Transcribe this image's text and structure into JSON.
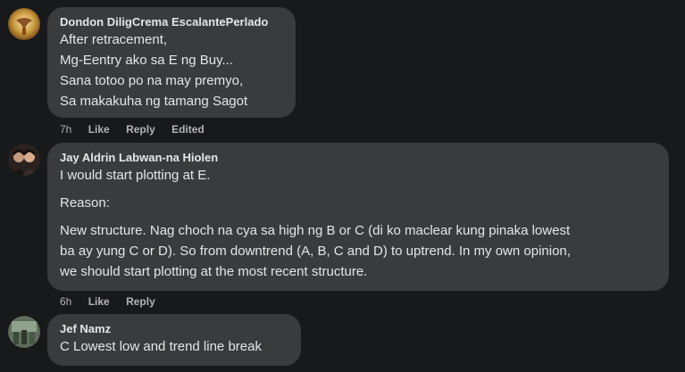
{
  "comments": [
    {
      "author": "Dondon DiligCrema EscalantePerlado",
      "lines": [
        "After retracement,",
        "Mg-Eentry ako sa E ng Buy...",
        "Sana totoo po na may premyo,",
        "Sa makakuha ng tamang Sagot"
      ],
      "time": "7h",
      "like": "Like",
      "reply": "Reply",
      "extra": "Edited"
    },
    {
      "author": "Jay Aldrin Labwan-na Hiolen",
      "p1": "I would start plotting at E.",
      "p2": "Reason:",
      "p3": [
        "New structure. Nag choch na cya sa high ng B or C (di ko maclear kung pinaka lowest",
        "ba ay yung C or D). So from downtrend (A, B, C and D) to uptrend. In my own opinion,",
        "we should start plotting at the most recent structure."
      ],
      "time": "6h",
      "like": "Like",
      "reply": "Reply"
    },
    {
      "author": "Jef Namz",
      "lines": [
        "C Lowest low and trend line break"
      ]
    }
  ],
  "icons": {
    "avatar1": "avatar-gold-emblem-icon",
    "avatar2": "avatar-photo-icon",
    "avatar3": "avatar-photo-icon"
  },
  "colors": {
    "background": "#18191a",
    "bubble": "#3a3b3c",
    "text": "#e4e6eb",
    "secondary": "#b0b3b8"
  }
}
